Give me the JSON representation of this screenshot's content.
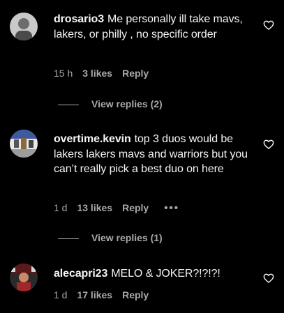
{
  "comments": [
    {
      "username": "drosario3",
      "text": "Me personally ill take mavs, lakers, or philly , no specific order",
      "age": "15 h",
      "likes": "3 likes",
      "reply_label": "Reply",
      "view_replies": "View replies (2)"
    },
    {
      "username": "overtime.kevin",
      "text": "top 3 duos would be lakers lakers mavs and warriors but you can’t really pick a best duo on here",
      "age": "1 d",
      "likes": "13 likes",
      "reply_label": "Reply",
      "more_label": "•••",
      "view_replies": "View replies (1)"
    },
    {
      "username": "alecapri23",
      "text": "MELO & JOKER?!?!?!",
      "age": "1 d",
      "likes": "17 likes",
      "reply_label": "Reply"
    }
  ],
  "colors": {
    "background": "#000000",
    "primary_text": "#f5f5f5",
    "secondary_text": "#a8a8a8"
  },
  "icons": {
    "like": "heart-outline-icon",
    "more": "more-options-icon"
  }
}
